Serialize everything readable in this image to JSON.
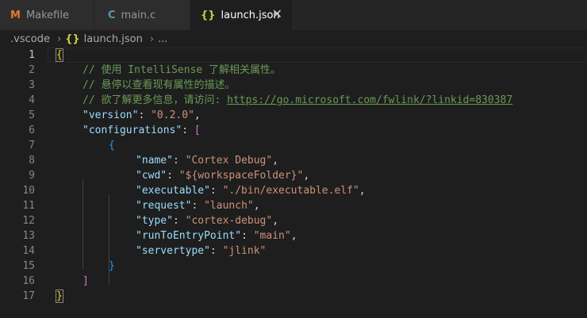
{
  "tabs": [
    {
      "icon": "M",
      "icon_color": "#e37933",
      "label": "Makefile"
    },
    {
      "icon": "C",
      "icon_color": "#519aba",
      "label": "main.c"
    },
    {
      "icon": "{}",
      "icon_color": "#cbcb41",
      "label": "launch.json",
      "close": "✕"
    }
  ],
  "breadcrumb": {
    "folder": ".vscode",
    "file": "launch.json",
    "ellipsis": "..."
  },
  "gutter": [
    "1",
    "2",
    "3",
    "4",
    "5",
    "6",
    "7",
    "8",
    "9",
    "10",
    "11",
    "12",
    "13",
    "14",
    "15",
    "16",
    "17"
  ],
  "code": {
    "l1_brace": "{",
    "l2_comment": "// 使用 IntelliSense 了解相关属性。",
    "l3_comment": "// 悬停以查看现有属性的描述。",
    "l4_comment": "// 欲了解更多信息，请访问: ",
    "l4_link": "https://go.microsoft.com/fwlink/?linkid=830387",
    "l5_key": "\"version\"",
    "l5_value": "\"0.2.0\"",
    "l6_key": "\"configurations\"",
    "l6_bracket": "[",
    "l7_brace": "{",
    "l8_key": "\"name\"",
    "l8_value": "\"Cortex Debug\"",
    "l9_key": "\"cwd\"",
    "l9_value": "\"${workspaceFolder}\"",
    "l10_key": "\"executable\"",
    "l10_value": "\"./bin/executable.elf\"",
    "l11_key": "\"request\"",
    "l11_value": "\"launch\"",
    "l12_key": "\"type\"",
    "l12_value": "\"cortex-debug\"",
    "l13_key": "\"runToEntryPoint\"",
    "l13_value": "\"main\"",
    "l14_key": "\"servertype\"",
    "l14_value": "\"jlink\"",
    "l15_brace": "}",
    "l16_bracket": "]",
    "l17_brace": "}",
    "colon": ": ",
    "comma": ","
  }
}
